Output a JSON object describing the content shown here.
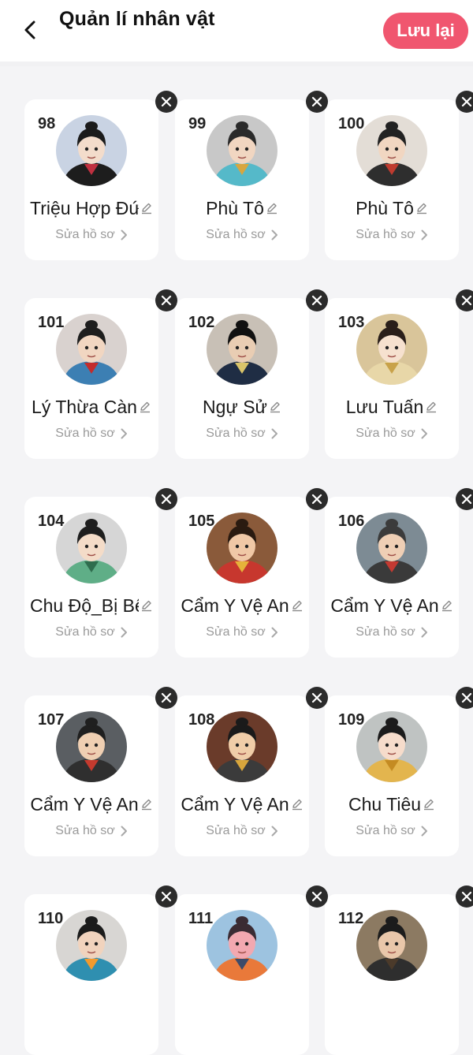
{
  "header": {
    "title": "Quản lí nhân vật",
    "save_label": "Lưu lại"
  },
  "colors": {
    "accent": "#f0566f",
    "card_bg": "#ffffff",
    "page_bg": "#f4f4f6",
    "close_bg": "#2b2b2b"
  },
  "characters": [
    {
      "num": "98",
      "name": "Triệu Hợp Đứ",
      "profile_label": "Sửa hồ sơ",
      "avatar": "portrait-woman-icon"
    },
    {
      "num": "99",
      "name": "Phù Tô",
      "profile_label": "Sửa hồ sơ",
      "avatar": "portrait-prince-icon"
    },
    {
      "num": "100",
      "name": "Phù Tô",
      "profile_label": "Sửa hồ sơ",
      "avatar": "portrait-group-icon"
    },
    {
      "num": "101",
      "name": "Lý Thừa Càn",
      "profile_label": "Sửa hồ sơ",
      "avatar": "portrait-man-icon"
    },
    {
      "num": "102",
      "name": "Ngự Sử",
      "profile_label": "Sửa hồ sơ",
      "avatar": "portrait-official-icon"
    },
    {
      "num": "103",
      "name": "Lưu Tuấn",
      "profile_label": "Sửa hồ sơ",
      "avatar": "portrait-lady-icon"
    },
    {
      "num": "104",
      "name": "Chu Độ_Bị Bệ",
      "profile_label": "Sửa hồ sơ",
      "avatar": "portrait-scholar-icon"
    },
    {
      "num": "105",
      "name": "Cẩm Y Vệ An",
      "profile_label": "Sửa hồ sơ",
      "avatar": "portrait-guard-icon"
    },
    {
      "num": "106",
      "name": "Cẩm Y Vệ An",
      "profile_label": "Sửa hồ sơ",
      "avatar": "portrait-helmet-icon"
    },
    {
      "num": "107",
      "name": "Cẩm Y Vệ An",
      "profile_label": "Sửa hồ sơ",
      "avatar": "portrait-elder-icon"
    },
    {
      "num": "108",
      "name": "Cẩm Y Vệ An",
      "profile_label": "Sửa hồ sơ",
      "avatar": "portrait-armor-icon"
    },
    {
      "num": "109",
      "name": "Chu Tiêu",
      "profile_label": "Sửa hồ sơ",
      "avatar": "portrait-crown-icon"
    },
    {
      "num": "110",
      "name": "",
      "profile_label": "",
      "avatar": "portrait-blue-icon"
    },
    {
      "num": "111",
      "name": "",
      "profile_label": "",
      "avatar": "portrait-pink-icon"
    },
    {
      "num": "112",
      "name": "",
      "profile_label": "",
      "avatar": "portrait-dark-icon"
    }
  ]
}
